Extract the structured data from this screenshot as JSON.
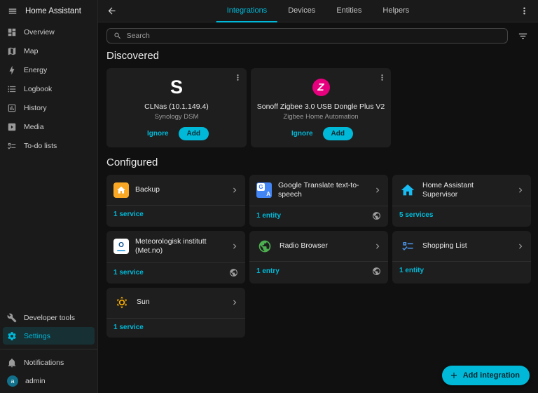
{
  "app": {
    "title": "Home Assistant"
  },
  "sidebar": {
    "items": [
      {
        "label": "Overview",
        "icon": "view-dashboard-icon"
      },
      {
        "label": "Map",
        "icon": "map-icon"
      },
      {
        "label": "Energy",
        "icon": "flash-icon"
      },
      {
        "label": "Logbook",
        "icon": "list-icon"
      },
      {
        "label": "History",
        "icon": "chart-box-icon"
      },
      {
        "label": "Media",
        "icon": "play-box-icon"
      },
      {
        "label": "To-do lists",
        "icon": "check-list-icon"
      }
    ],
    "developer_tools": "Developer tools",
    "settings": "Settings",
    "notifications": "Notifications",
    "user": "admin",
    "user_initial": "a"
  },
  "header": {
    "tabs": [
      {
        "label": "Integrations",
        "active": true
      },
      {
        "label": "Devices",
        "active": false
      },
      {
        "label": "Entities",
        "active": false
      },
      {
        "label": "Helpers",
        "active": false
      }
    ]
  },
  "search": {
    "placeholder": "Search"
  },
  "sections": {
    "discovered": "Discovered",
    "configured": "Configured"
  },
  "discovered": [
    {
      "name": "CLNas (10.1.149.4)",
      "subtitle": "Synology DSM",
      "ignore_label": "Ignore",
      "add_label": "Add",
      "logo": "S"
    },
    {
      "name": "Sonoff Zigbee 3.0 USB Dongle Plus V2",
      "subtitle": "Zigbee Home Automation",
      "ignore_label": "Ignore",
      "add_label": "Add",
      "logo": "Z"
    }
  ],
  "configured": [
    {
      "name": "Backup",
      "meta": "1 service",
      "cloud": false
    },
    {
      "name": "Google Translate text-to-speech",
      "meta": "1 entity",
      "cloud": true
    },
    {
      "name": "Home Assistant Supervisor",
      "meta": "5 services",
      "cloud": false
    },
    {
      "name": "Meteorologisk institutt (Met.no)",
      "meta": "1 service",
      "cloud": true
    },
    {
      "name": "Radio Browser",
      "meta": "1 entry",
      "cloud": true
    },
    {
      "name": "Shopping List",
      "meta": "1 entity",
      "cloud": false
    },
    {
      "name": "Sun",
      "meta": "1 service",
      "cloud": false
    }
  ],
  "fab": {
    "label": "Add integration"
  },
  "colors": {
    "accent": "#00b9d8",
    "background": "#101010",
    "surface": "#1a1a1a",
    "card": "#1e1e1e",
    "zigbee_logo": "#e6007d",
    "backup_icon": "#f9a825",
    "supervisor_icon": "#18bcf2",
    "google_translate_icon": "#4285f4",
    "radio_browser_icon": "#4caf50",
    "shopping_list_icon": "#4a8fe0",
    "sun_icon": "#ffb300"
  }
}
